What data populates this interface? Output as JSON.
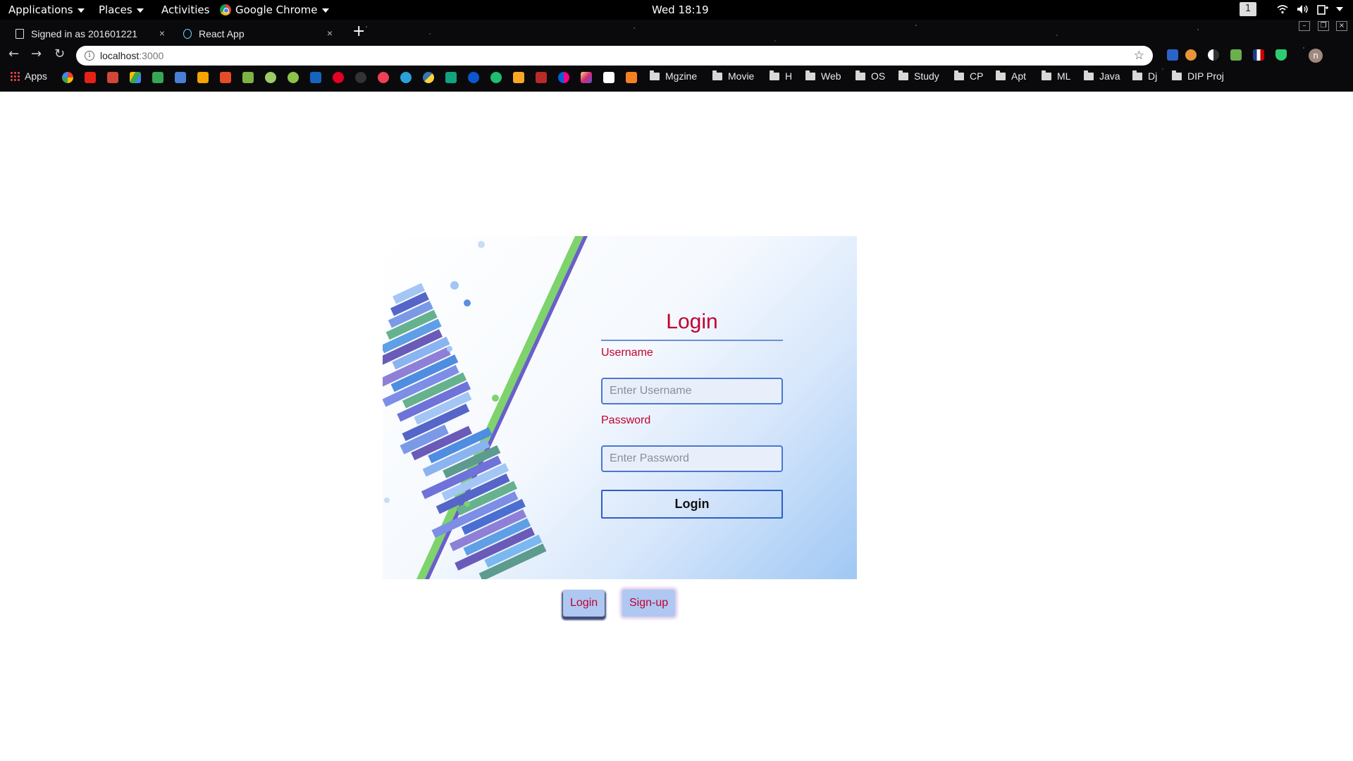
{
  "gnome_bar": {
    "applications": "Applications",
    "places": "Places",
    "activities": "Activities",
    "chrome_app": "Google Chrome",
    "clock": "Wed 18:19",
    "workspace": "1"
  },
  "browser": {
    "tabs": [
      {
        "title": "Signed in as 201601221",
        "close": "×"
      },
      {
        "title": "React App",
        "close": "×"
      }
    ],
    "new_tab": "+",
    "url_host": "localhost",
    "url_port": ":3000",
    "info_glyph": "i",
    "star_glyph": "☆",
    "profile_initial": "n",
    "bookmarks": {
      "apps": "Apps",
      "folders": [
        "Mgzine",
        "Movie",
        "H",
        "Web",
        "OS",
        "Study",
        "CP",
        "Apt",
        "ML",
        "Java",
        "Dj",
        "DIP Proj"
      ]
    }
  },
  "login": {
    "title": "Login",
    "username_label": "Username",
    "username_placeholder": "Enter Username",
    "password_label": "Password",
    "password_placeholder": "Enter Password",
    "submit_label": "Login"
  },
  "switcher": {
    "login": "Login",
    "signup": "Sign-up"
  },
  "colors": {
    "accent_red": "#c2002f",
    "input_border": "#4a78d0",
    "card_gradient_end": "#a0c8f4",
    "switch_bg": "#aec8f2"
  }
}
